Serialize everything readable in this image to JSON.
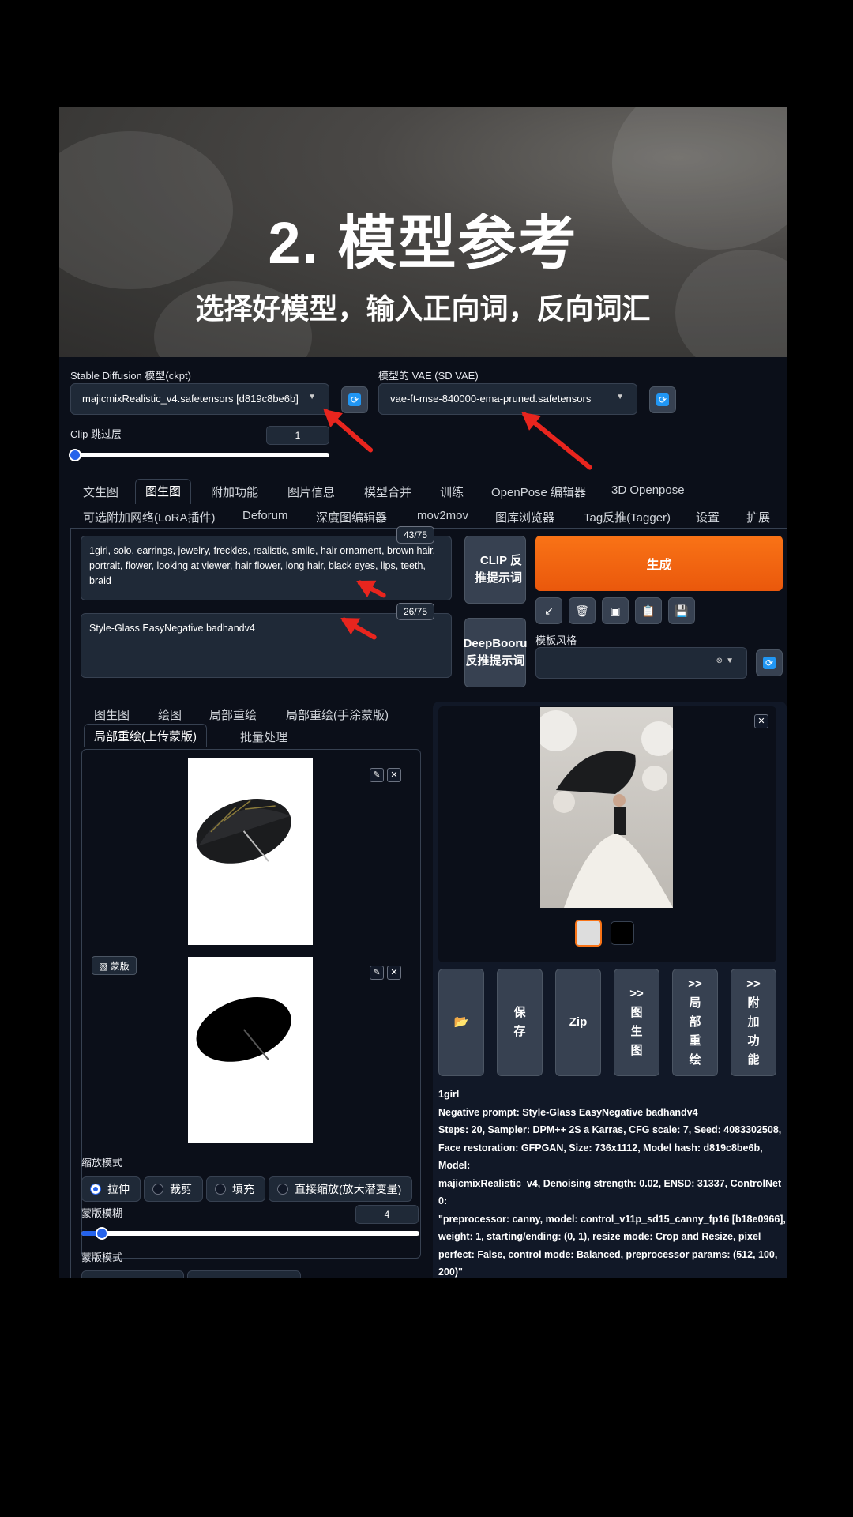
{
  "banner": {
    "title": "2. 模型参考",
    "subtitle": "选择好模型，输入正向词，反向词汇"
  },
  "top": {
    "ckpt_label": "Stable Diffusion 模型(ckpt)",
    "ckpt_value": "majicmixRealistic_v4.safetensors [d819c8be6b]",
    "vae_label": "模型的 VAE (SD VAE)",
    "vae_value": "vae-ft-mse-840000-ema-pruned.safetensors",
    "clip_label": "Clip 跳过层",
    "clip_value": "1",
    "clip_fraction": 0.0
  },
  "main_tabs": [
    "文生图",
    "图生图",
    "附加功能",
    "图片信息",
    "模型合并",
    "训练",
    "OpenPose 编辑器",
    "3D Openpose"
  ],
  "main_tab_active": "图生图",
  "sub_tabs": [
    "可选附加网络(LoRA插件)",
    "Deforum",
    "深度图编辑器",
    "mov2mov",
    "图库浏览器",
    "Tag反推(Tagger)",
    "设置",
    "扩展"
  ],
  "prompt": {
    "positive": "1girl, solo, earrings, jewelry, freckles, realistic, smile, hair ornament, brown hair, portrait, flower, looking at viewer, hair flower, long hair, black eyes, lips, teeth, braid",
    "positive_count": "43/75",
    "negative": "Style-Glass EasyNegative badhandv4",
    "negative_count": "26/75"
  },
  "buttons": {
    "clip": "CLIP 反推提示词",
    "deepbooru": "DeepBooru 反推提示词",
    "generate": "生成",
    "style_label": "模板风格"
  },
  "img_tabs": [
    "图生图",
    "绘图",
    "局部重绘",
    "局部重绘(手涂蒙版)"
  ],
  "img_tabs2": [
    "局部重绘(上传蒙版)",
    "批量处理"
  ],
  "mask_label": "蒙版",
  "resize": {
    "label": "缩放模式",
    "options": [
      "拉伸",
      "裁剪",
      "填充",
      "直接缩放(放大潜变量)"
    ],
    "selected": "拉伸"
  },
  "mask_blur": {
    "label": "蒙版模糊",
    "value": "4",
    "fraction": 0.06
  },
  "mask_mode_label": "蒙版模式",
  "gallery_buttons": [
    ">> 图生图",
    ">> 局部重绘",
    ">> 附加功能"
  ],
  "gallery_simple": [
    "保存",
    "Zip"
  ],
  "output_info": {
    "line1": "1girl",
    "line2": "Negative prompt: Style-Glass EasyNegative badhandv4",
    "line3": "Steps: 20, Sampler: DPM++ 2S a Karras, CFG scale: 7, Seed: 4083302508,",
    "line4": "Face restoration: GFPGAN, Size: 736x1112, Model hash: d819c8be6b, Model:",
    "line5": "majicmixRealistic_v4, Denoising strength: 0.02, ENSD: 31337, ControlNet 0:",
    "line6": "\"preprocessor: canny, model: control_v11p_sd15_canny_fp16 [b18e0966],",
    "line7": "weight: 1, starting/ending: (0, 1), resize mode: Crop and Resize, pixel",
    "line8": "perfect: False, control mode: Balanced, preprocessor params: (512, 100,",
    "line9": "200)\""
  },
  "colors": {
    "accent": "#ea580c",
    "arrow": "#e8251e",
    "bg": "#0b0f19"
  }
}
